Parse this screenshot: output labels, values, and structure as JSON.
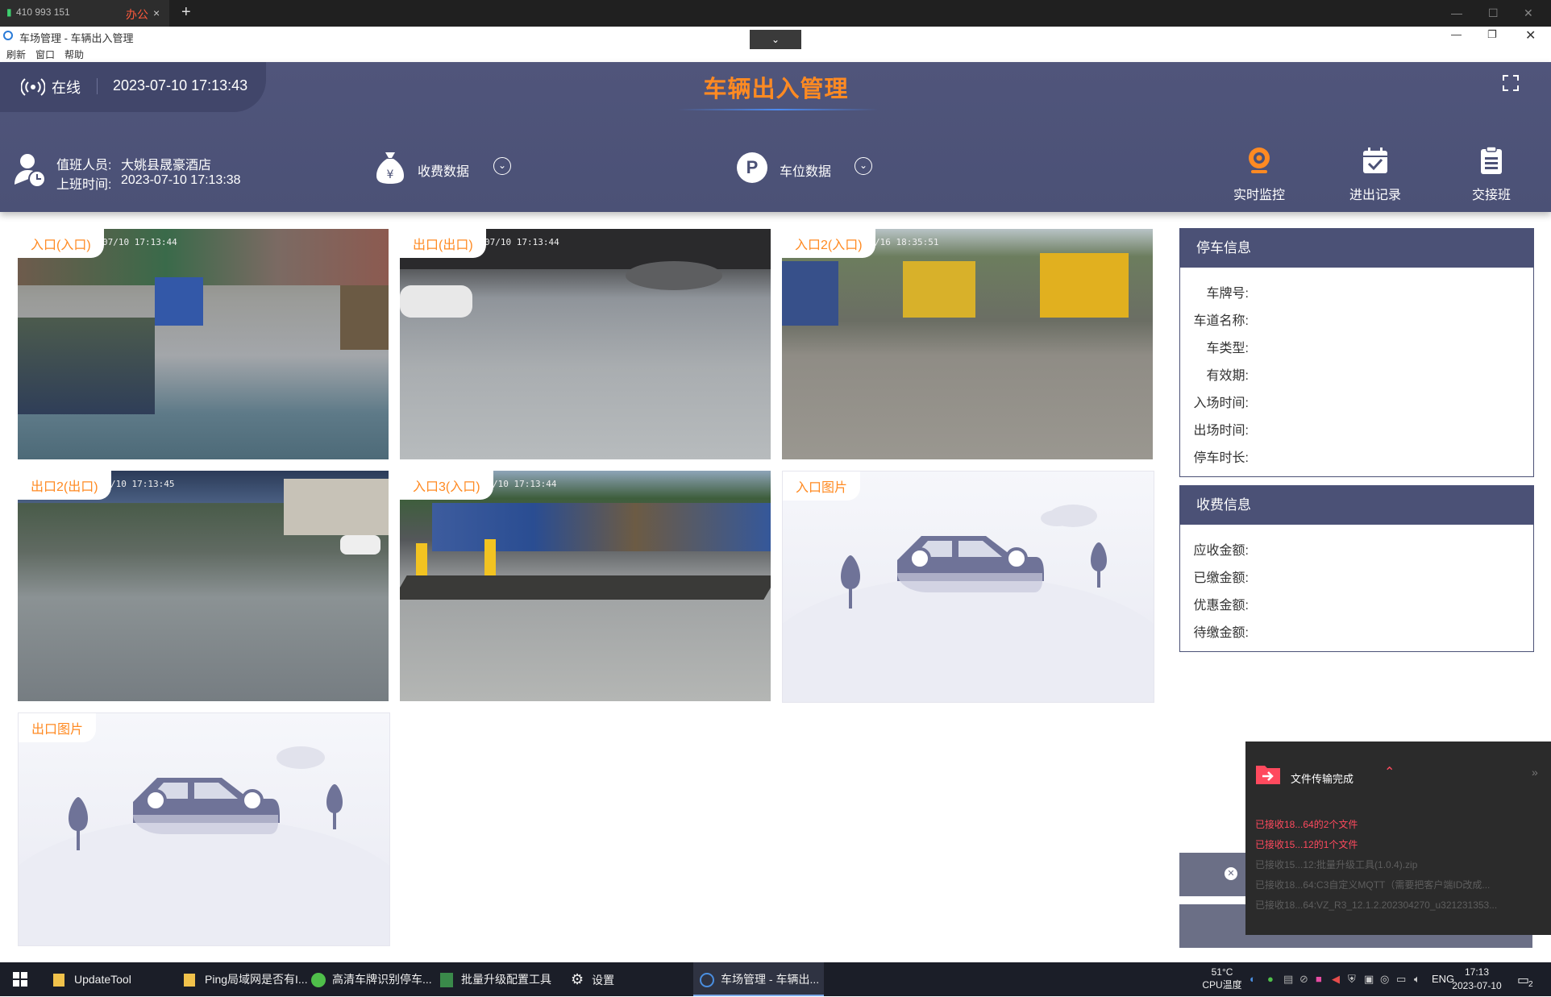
{
  "remote_bar": {
    "connection_id": "410 993 151",
    "session_tab": "办公",
    "close_symbol": "×",
    "new_tab_symbol": "+"
  },
  "window": {
    "title": "车场管理 - 车辆出入管理",
    "menu": [
      "刷新",
      "窗口",
      "帮助"
    ]
  },
  "header": {
    "status": "在线",
    "datetime": "2023-07-10 17:13:43",
    "title": "车辆出入管理",
    "operator_label": "值班人员:",
    "operator_value": "大姚县晟豪酒店",
    "shift_label": "上班时间:",
    "shift_value": "2023-07-10 17:13:38",
    "fee_data": "收费数据",
    "space_data": "车位数据",
    "nav": [
      "实时监控",
      "进出记录",
      "交接班"
    ]
  },
  "cameras": [
    {
      "label": "入口(入口)",
      "timestamp": "07/10    17:13:44"
    },
    {
      "label": "出口(出口)",
      "timestamp": "07/10    17:13:44"
    },
    {
      "label": "入口2(入口)",
      "timestamp": "/16    18:35:51"
    },
    {
      "label": "出口2(出口)",
      "timestamp": "/10    17:13:45"
    },
    {
      "label": "入口3(入口)",
      "timestamp": "/10  17:13:44"
    }
  ],
  "placeholders": {
    "entry_image": "入口图片",
    "exit_image": "出口图片"
  },
  "parking_info": {
    "title": "停车信息",
    "fields": [
      "车牌号:",
      "车道名称:",
      "车类型:",
      "有效期:",
      "入场时间:",
      "出场时间:",
      "停车时长:"
    ]
  },
  "fee_info": {
    "title": "收费信息",
    "fields": [
      "应收金额:",
      "已缴金额:",
      "优惠金额:",
      "待缴金额:"
    ]
  },
  "toast": {
    "title": "文件传输完成",
    "lines": [
      "已接收18...64的2个文件",
      "已接收15...12的1个文件",
      "已接收15...12:批量升级工具(1.0.4).zip",
      "已接收18...64:C3自定义MQTT（需要把客户端ID改成...",
      "已接收18...64:VZ_R3_12.1.2.202304270_u321231353..."
    ]
  },
  "taskbar": {
    "apps": [
      "UpdateTool",
      "Ping局域网是否有I...",
      "高清车牌识别停车...",
      "批量升级配置工具",
      "设置",
      "车场管理 - 车辆出..."
    ],
    "temp": "51°C",
    "temp_label": "CPU温度",
    "lang": "ENG",
    "time": "17:13",
    "date": "2023-07-10",
    "notif_count": "2"
  },
  "colors": {
    "header_bg": "#4b5176",
    "accent_orange": "#ff8a22",
    "toast_bg": "#2b2b2b",
    "toast_red": "#ff4a5e"
  }
}
